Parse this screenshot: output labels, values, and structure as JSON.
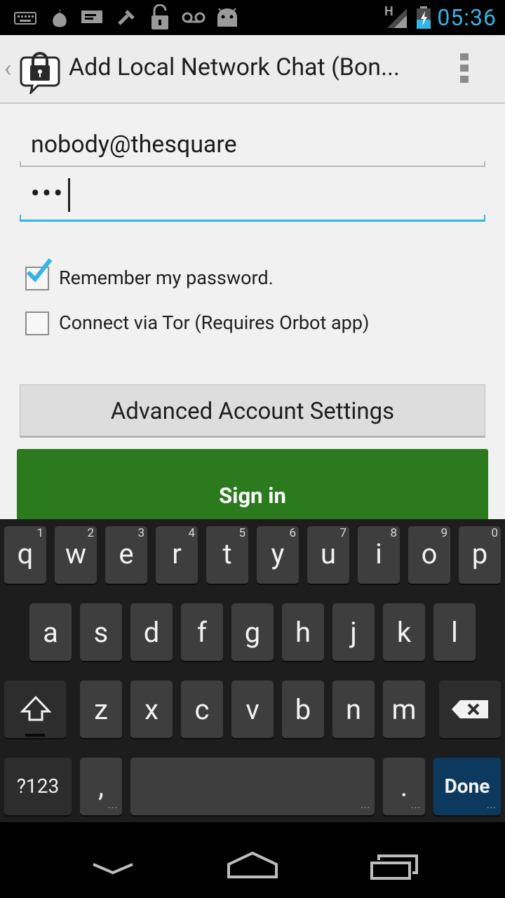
{
  "status_bar": {
    "icons": [
      "keyboard-icon",
      "orbot-onion-icon",
      "message-icon",
      "tools-icon",
      "unlock-icon",
      "voicemail-icon",
      "android-icon"
    ],
    "network_type": "H",
    "time": "05:36",
    "accent_color": "#33b5e5"
  },
  "action_bar": {
    "title": "Add Local Network Chat (Bon...",
    "icon": "lock-chat-bubble-icon"
  },
  "form": {
    "username": "nobody@thesquare",
    "password_masked": "•••",
    "remember_label": "Remember my password.",
    "remember_checked": true,
    "tor_label": "Connect via Tor (Requires Orbot app)",
    "tor_checked": false,
    "advanced_label": "Advanced Account Settings",
    "signin_label": "Sign in",
    "signin_color": "#2b7a1e"
  },
  "keyboard": {
    "row1": [
      {
        "label": "q",
        "hint": "1"
      },
      {
        "label": "w",
        "hint": "2"
      },
      {
        "label": "e",
        "hint": "3"
      },
      {
        "label": "r",
        "hint": "4"
      },
      {
        "label": "t",
        "hint": "5"
      },
      {
        "label": "y",
        "hint": "6"
      },
      {
        "label": "u",
        "hint": "7"
      },
      {
        "label": "i",
        "hint": "8"
      },
      {
        "label": "o",
        "hint": "9"
      },
      {
        "label": "p",
        "hint": "0"
      }
    ],
    "row2": [
      {
        "label": "a"
      },
      {
        "label": "s"
      },
      {
        "label": "d"
      },
      {
        "label": "f"
      },
      {
        "label": "g"
      },
      {
        "label": "h"
      },
      {
        "label": "j"
      },
      {
        "label": "k"
      },
      {
        "label": "l"
      }
    ],
    "row3": [
      {
        "label": "z"
      },
      {
        "label": "x"
      },
      {
        "label": "c"
      },
      {
        "label": "v"
      },
      {
        "label": "b"
      },
      {
        "label": "n"
      },
      {
        "label": "m"
      }
    ],
    "symbols_label": "?123",
    "comma_label": ",",
    "period_label": ".",
    "done_label": "Done"
  },
  "nav_bar": {
    "icons": [
      "back-icon",
      "home-icon",
      "recent-apps-icon"
    ]
  }
}
